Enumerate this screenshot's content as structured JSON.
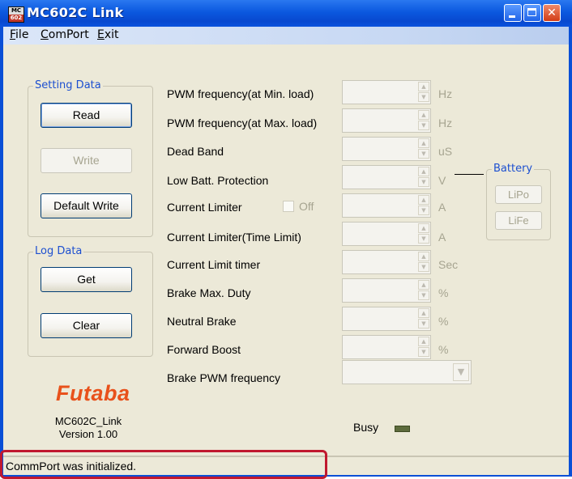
{
  "window": {
    "title": "MC602C Link",
    "icon_top": "MC",
    "icon_bottom": "602"
  },
  "menu": {
    "file": "File",
    "comport": "ComPort",
    "exit": "Exit"
  },
  "setting_data": {
    "title": "Setting Data",
    "read": "Read",
    "write": "Write",
    "default_write": "Default Write"
  },
  "log_data": {
    "title": "Log Data",
    "get": "Get",
    "clear": "Clear"
  },
  "params": [
    {
      "label": "PWM frequency(at Min. load)",
      "unit": "Hz"
    },
    {
      "label": "PWM frequency(at Max. load)",
      "unit": "Hz"
    },
    {
      "label": "Dead Band",
      "unit": "uS"
    },
    {
      "label": "Low Batt. Protection",
      "unit": "V"
    },
    {
      "label": "Current Limiter",
      "unit": "A"
    },
    {
      "label": "Current Limiter(Time Limit)",
      "unit": "A"
    },
    {
      "label": "Current Limit timer",
      "unit": "Sec"
    },
    {
      "label": "Brake Max. Duty",
      "unit": "%"
    },
    {
      "label": "Neutral Brake",
      "unit": "%"
    },
    {
      "label": "Forward Boost",
      "unit": "%"
    },
    {
      "label": "Brake PWM frequency",
      "unit": ""
    }
  ],
  "current_limiter_checkbox": {
    "label": "Off",
    "checked": false
  },
  "battery": {
    "title": "Battery",
    "lipo": "LiPo",
    "life": "LiFe"
  },
  "logo": "Futaba",
  "app_info": {
    "name": "MC602C_Link",
    "version": "Version 1.00"
  },
  "busy_label": "Busy",
  "status": "CommPort was initialized.",
  "colors": {
    "title_blue": "#0b58df",
    "logo_orange": "#e8511b",
    "highlight_red": "#c0182f",
    "group_title_blue": "#1c4fd0"
  }
}
